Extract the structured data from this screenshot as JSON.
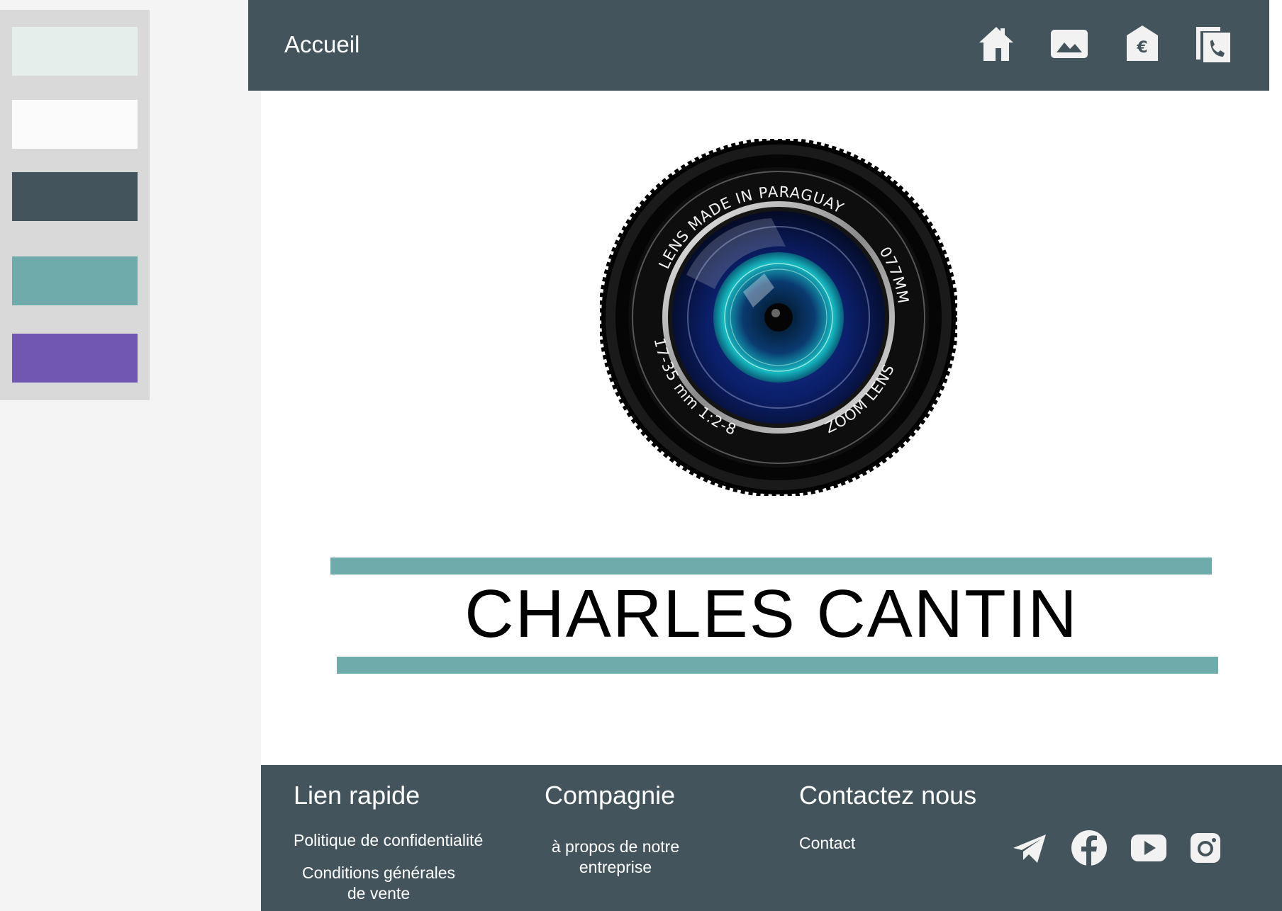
{
  "palette": {
    "swatches": [
      "#e6eeec",
      "#fbfbfb",
      "#44545c",
      "#6fabaa",
      "#7257b2"
    ]
  },
  "navbar": {
    "title": "Accueil",
    "icons": [
      "home-icon",
      "image-icon",
      "bank-euro-icon",
      "contact-phone-icon"
    ]
  },
  "hero": {
    "lens_text_top": "LENS MADE IN PARAGUAY",
    "lens_text_right": "077MM",
    "lens_text_bottom_left": "17-35 mm 1:2-8",
    "lens_text_bottom_right": "ZOOM LENS",
    "name": "CHARLES CANTIN",
    "accent_color": "#6fabaa"
  },
  "footer": {
    "quick_links": {
      "heading": "Lien rapide",
      "privacy": "Politique de confidentialité",
      "terms_line1": "Conditions générales",
      "terms_line2": "de vente"
    },
    "company": {
      "heading": "Compagnie",
      "about_line1": "à propos de notre",
      "about_line2": "entreprise"
    },
    "contact": {
      "heading": "Contactez nous",
      "contact": "Contact"
    },
    "social_icons": [
      "telegram-icon",
      "facebook-icon",
      "youtube-icon",
      "instagram-icon"
    ]
  }
}
